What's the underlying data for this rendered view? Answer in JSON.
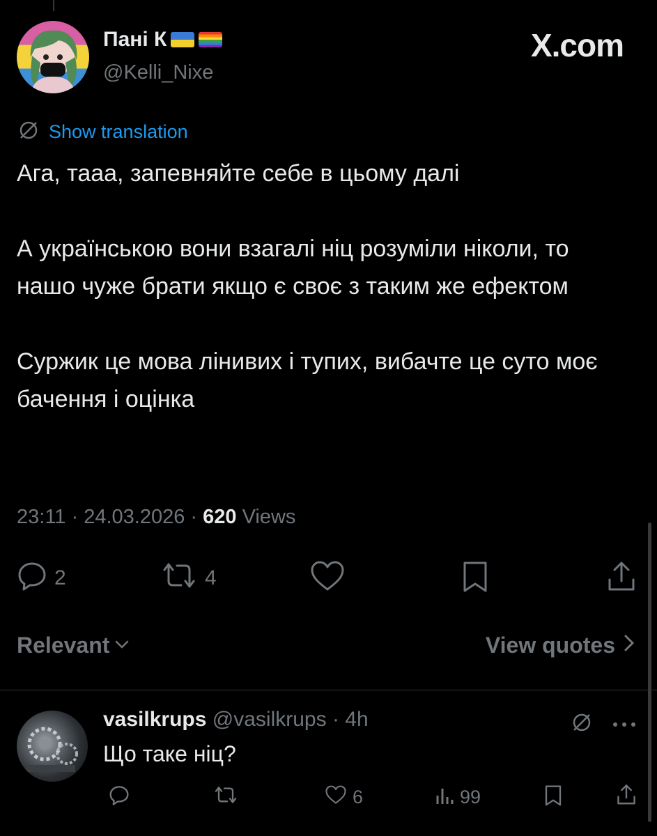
{
  "tweet": {
    "author_name": "Пані К",
    "author_handle": "@Kelli_Nixe",
    "site_logo": "X.com",
    "translate_label": "Show translation",
    "paragraphs": [
      "Ага, тааа, запевняйте себе в цьому далі",
      "А українською вони взагалі ніц розуміли ніколи, то нашо чуже брати якщо є своє з таким же ефектом",
      "Суржик це мова лінивих і тупих, вибачте це суто моє бачення і оцінка"
    ],
    "time": "23:11",
    "date": "24.03.2026",
    "views_count": "620",
    "views_label": "Views",
    "actions": {
      "replies": "2",
      "reposts": "4"
    }
  },
  "sort": {
    "label": "Relevant",
    "view_quotes": "View quotes"
  },
  "reply": {
    "name": "vasilkrups",
    "handle": "@vasilkrups",
    "age": "4h",
    "text": "Що таке ніц?",
    "likes": "6",
    "views": "99"
  },
  "icons": [
    "translate-icon",
    "reply-icon",
    "repost-icon",
    "like-icon",
    "bookmark-icon",
    "share-icon",
    "chevron-down-icon",
    "chevron-right-icon",
    "more-icon",
    "views-icon"
  ],
  "colors": {
    "background": "#000000",
    "text": "#e7e9ea",
    "muted": "#71767b",
    "link": "#1d9bf0"
  }
}
